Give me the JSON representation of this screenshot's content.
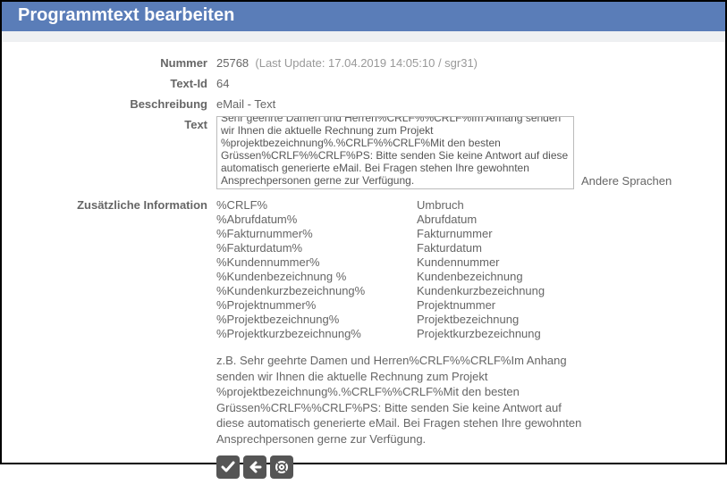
{
  "header": {
    "title": "Programmtext bearbeiten"
  },
  "fields": {
    "nummer_label": "Nummer",
    "nummer_value": "25768",
    "nummer_meta": "(Last Update: 17.04.2019 14:05:10 / sgr31)",
    "textid_label": "Text-Id",
    "textid_value": "64",
    "beschreibung_label": "Beschreibung",
    "beschreibung_value": "eMail - Text",
    "text_label": "Text",
    "text_value": "Sehr geehrte Damen und Herren%CRLF%%CRLF%Im Anhang senden wir Ihnen die aktuelle Rechnung zum Projekt %projektbezeichnung%.%CRLF%%CRLF%Mit den besten Grüssen%CRLF%%CRLF%PS: Bitte senden Sie keine Antwort auf diese automatisch generierte eMail. Bei Fragen stehen Ihre gewohnten Ansprechpersonen gerne zur Verfügung.",
    "andere_sprachen": "Andere Sprachen",
    "info_label": "Zusätzliche Information",
    "info_rows": [
      {
        "ph": "%CRLF%",
        "desc": "Umbruch"
      },
      {
        "ph": "%Abrufdatum%",
        "desc": "Abrufdatum"
      },
      {
        "ph": "%Fakturnummer%",
        "desc": "Fakturnummer"
      },
      {
        "ph": "%Fakturdatum%",
        "desc": "Fakturdatum"
      },
      {
        "ph": "%Kundennummer%",
        "desc": "Kundennummer"
      },
      {
        "ph": "%Kundenbezeichnung %",
        "desc": "Kundenbezeichnung"
      },
      {
        "ph": "%Kundenkurzbezeichnung%",
        "desc": "Kundenkurzbezeichnung"
      },
      {
        "ph": "%Projektnummer%",
        "desc": "Projektnummer"
      },
      {
        "ph": "%Projektbezeichnung%",
        "desc": "Projektbezeichnung"
      },
      {
        "ph": "%Projektkurzbezeichnung%",
        "desc": "Projektkurzbezeichnung"
      }
    ],
    "example": "z.B. Sehr geehrte Damen und Herren%CRLF%%CRLF%Im Anhang senden wir Ihnen die aktuelle Rechnung zum Projekt %projektbezeichnung%.%CRLF%%CRLF%Mit den besten Grüssen%CRLF%%CRLF%PS: Bitte senden Sie keine Antwort auf diese automatisch generierte eMail. Bei Fragen stehen Ihre gewohnten Ansprechpersonen gerne zur Verfügung."
  }
}
